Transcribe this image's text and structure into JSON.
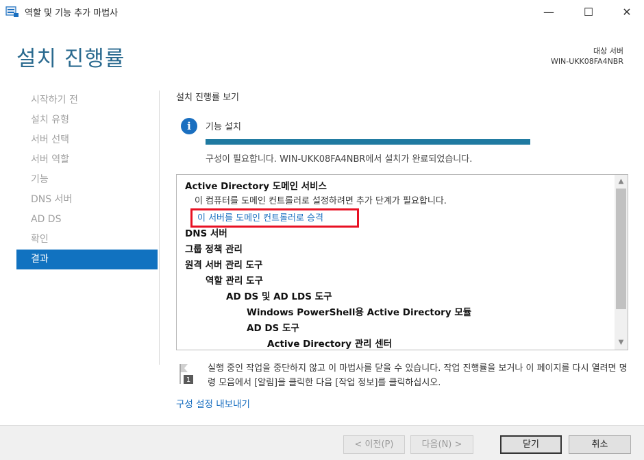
{
  "window": {
    "title": "역할 및 기능 추가 마법사",
    "minimize": "—",
    "maximize": "☐",
    "close": "✕"
  },
  "header": {
    "title": "설치 진행률",
    "destination_label": "대상 서버",
    "destination_server": "WIN-UKK08FA4NBR"
  },
  "nav": {
    "items": [
      {
        "label": "시작하기 전",
        "active": false
      },
      {
        "label": "설치 유형",
        "active": false
      },
      {
        "label": "서버 선택",
        "active": false
      },
      {
        "label": "서버 역할",
        "active": false
      },
      {
        "label": "기능",
        "active": false
      },
      {
        "label": "DNS 서버",
        "active": false
      },
      {
        "label": "AD DS",
        "active": false
      },
      {
        "label": "확인",
        "active": false
      },
      {
        "label": "결과",
        "active": true
      }
    ]
  },
  "main": {
    "section_label": "설치 진행률 보기",
    "info_icon_glyph": "i",
    "feature_install": "기능 설치",
    "progress_fraction": 1.0,
    "status": "구성이 필요합니다. WIN-UKK08FA4NBR에서 설치가 완료되었습니다.",
    "results": {
      "adds_title": "Active Directory 도메인 서비스",
      "adds_note": "이 컴퓨터를 도메인 컨트롤러로 설정하려면 추가 단계가 필요합니다.",
      "promote_link": "이 서버를 도메인 컨트롤러로 승격",
      "dns": "DNS 서버",
      "gpm": "그룹 정책 관리",
      "rsat": "원격 서버 관리 도구",
      "role_admin_tools": "역할 관리 도구",
      "adds_adlds_tools": "AD DS 및 AD LDS 도구",
      "ps_module": "Windows PowerShell용 Active Directory 모듈",
      "adds_tools": "AD DS 도구",
      "ad_admin_center": "Active Directory 관리 센터"
    },
    "notice_badge": "1",
    "notice": "실행 중인 작업을 중단하지 않고 이 마법사를 닫을 수 있습니다. 작업 진행률을 보거나 이 페이지를 다시 열려면 명령 모음에서 [알림]을 클릭한 다음 [작업 정보]를 클릭하십시오.",
    "export_link": "구성 설정 내보내기"
  },
  "footer": {
    "prev": "< 이전(P)",
    "next": "다음(N) >",
    "close": "닫기",
    "cancel": "취소"
  },
  "colors": {
    "accent": "#1172c0",
    "title": "#2a6a8f",
    "progress": "#1f7aa1",
    "highlight_box": "#e81123",
    "link": "#1a6fc0"
  }
}
